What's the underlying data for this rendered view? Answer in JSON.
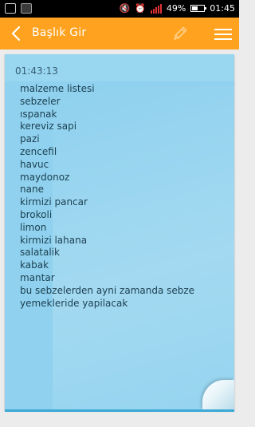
{
  "status_bar": {
    "battery_percent": "49%",
    "battery_level": 0.49,
    "time": "01:45",
    "icons": [
      "image-icon",
      "notification-icon",
      "mute-icon",
      "alarm-icon",
      "signal-icon",
      "battery-icon"
    ]
  },
  "app_bar": {
    "title": "Başlık Gir",
    "background": "#ffa21f"
  },
  "note": {
    "timestamp": "01:43:13",
    "background": "#8fd1ee",
    "lines": [
      "malzeme listesi",
      "sebzeler",
      "ıspanak",
      "kereviz sapi",
      "pazi",
      "zencefil",
      "havuc",
      "maydonoz",
      "nane",
      "kirmizi pancar",
      "brokoli",
      "limon",
      "kirmizi lahana",
      "salatalik",
      "kabak",
      "mantar",
      "bu sebzelerden ayni zamanda sebze",
      "yemekleride yapilacak"
    ]
  }
}
